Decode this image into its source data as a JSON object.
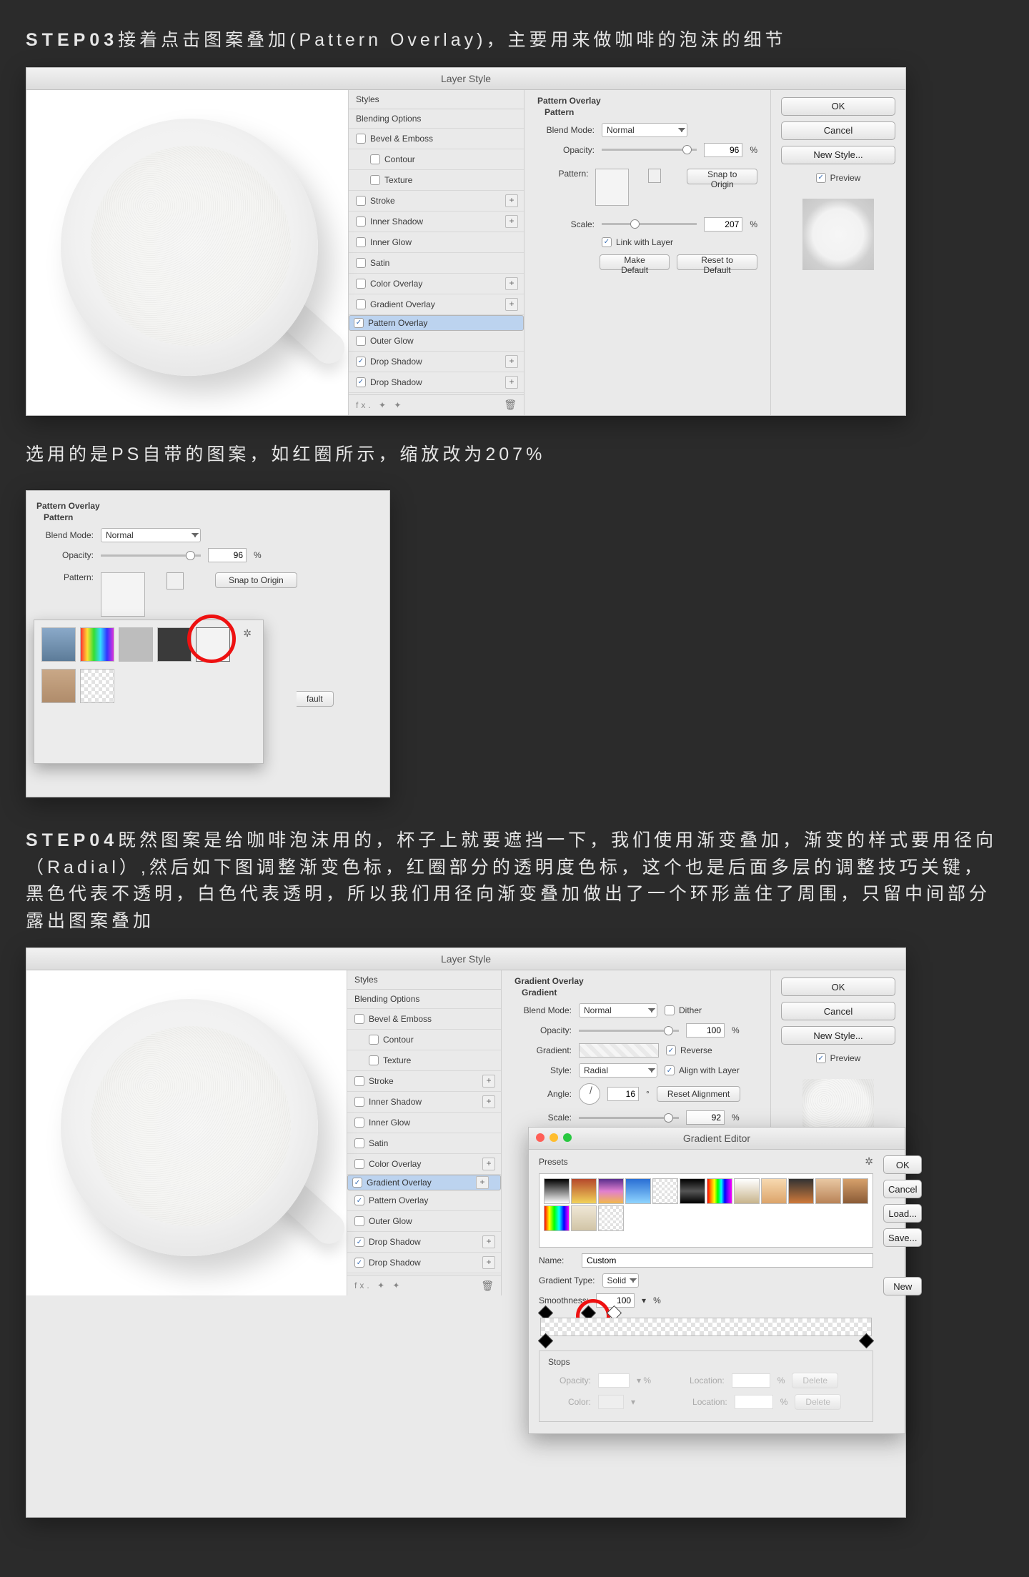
{
  "step3": {
    "num": "STEP03",
    "text": "接着点击图案叠加(Pattern Overlay)，主要用来做咖啡的泡沫的细节",
    "note": "选用的是PS自带的图案，如红圈所示，缩放改为207%"
  },
  "step4": {
    "num": "STEP04",
    "text": "既然图案是给咖啡泡沫用的，杯子上就要遮挡一下，我们使用渐变叠加，渐变的样式要用径向（Radial）,然后如下图调整渐变色标，红圈部分的透明度色标，这个也是后面多层的调整技巧关键，黑色代表不透明，白色代表透明，所以我们用径向渐变叠加做出了一个环形盖住了周围，只留中间部分露出图案叠加"
  },
  "layerStyleTitle": "Layer Style",
  "stylesHeader": "Styles",
  "blendingOptions": "Blending Options",
  "fx": {
    "bevel": "Bevel & Emboss",
    "contour": "Contour",
    "texture": "Texture",
    "stroke": "Stroke",
    "innerShadow": "Inner Shadow",
    "innerGlow": "Inner Glow",
    "satin": "Satin",
    "colorOverlay": "Color Overlay",
    "gradientOverlay": "Gradient Overlay",
    "patternOverlay": "Pattern Overlay",
    "outerGlow": "Outer Glow",
    "dropShadow": "Drop Shadow"
  },
  "rightButtons": {
    "ok": "OK",
    "cancel": "Cancel",
    "newStyle": "New Style...",
    "preview": "Preview"
  },
  "patternOverlay": {
    "group": "Pattern Overlay",
    "sub": "Pattern",
    "blendMode": "Blend Mode:",
    "blendVal": "Normal",
    "opacity": "Opacity:",
    "opacityVal": "96",
    "pct": "%",
    "pattern": "Pattern:",
    "snap": "Snap to Origin",
    "scale": "Scale:",
    "scaleVal": "207",
    "link": "Link with Layer",
    "makeDefault": "Make Default",
    "resetDefault": "Reset to Default"
  },
  "gradientOverlay": {
    "group": "Gradient Overlay",
    "sub": "Gradient",
    "blendMode": "Blend Mode:",
    "blendVal": "Normal",
    "dither": "Dither",
    "opacity": "Opacity:",
    "opacityVal": "100",
    "pct": "%",
    "gradient": "Gradient:",
    "reverse": "Reverse",
    "style": "Style:",
    "styleVal": "Radial",
    "align": "Align with Layer",
    "angle": "Angle:",
    "angleVal": "16",
    "deg": "°",
    "resetAlign": "Reset Alignment",
    "scale": "Scale:",
    "scaleVal": "92"
  },
  "gradientEditor": {
    "title": "Gradient Editor",
    "presets": "Presets",
    "ok": "OK",
    "cancel": "Cancel",
    "load": "Load...",
    "save": "Save...",
    "new": "New",
    "name": "Name:",
    "nameVal": "Custom",
    "type": "Gradient Type:",
    "typeVal": "Solid",
    "smoothness": "Smoothness:",
    "smoothVal": "100",
    "pct": "%",
    "stops": "Stops",
    "opacityL": "Opacity:",
    "locationL": "Location:",
    "colorL": "Color:",
    "delete": "Delete"
  },
  "fxIcons": "fx.  ✦  ✦",
  "gear": "✲",
  "trash": "🗑",
  "smallPop": {
    "fault": "fault"
  }
}
